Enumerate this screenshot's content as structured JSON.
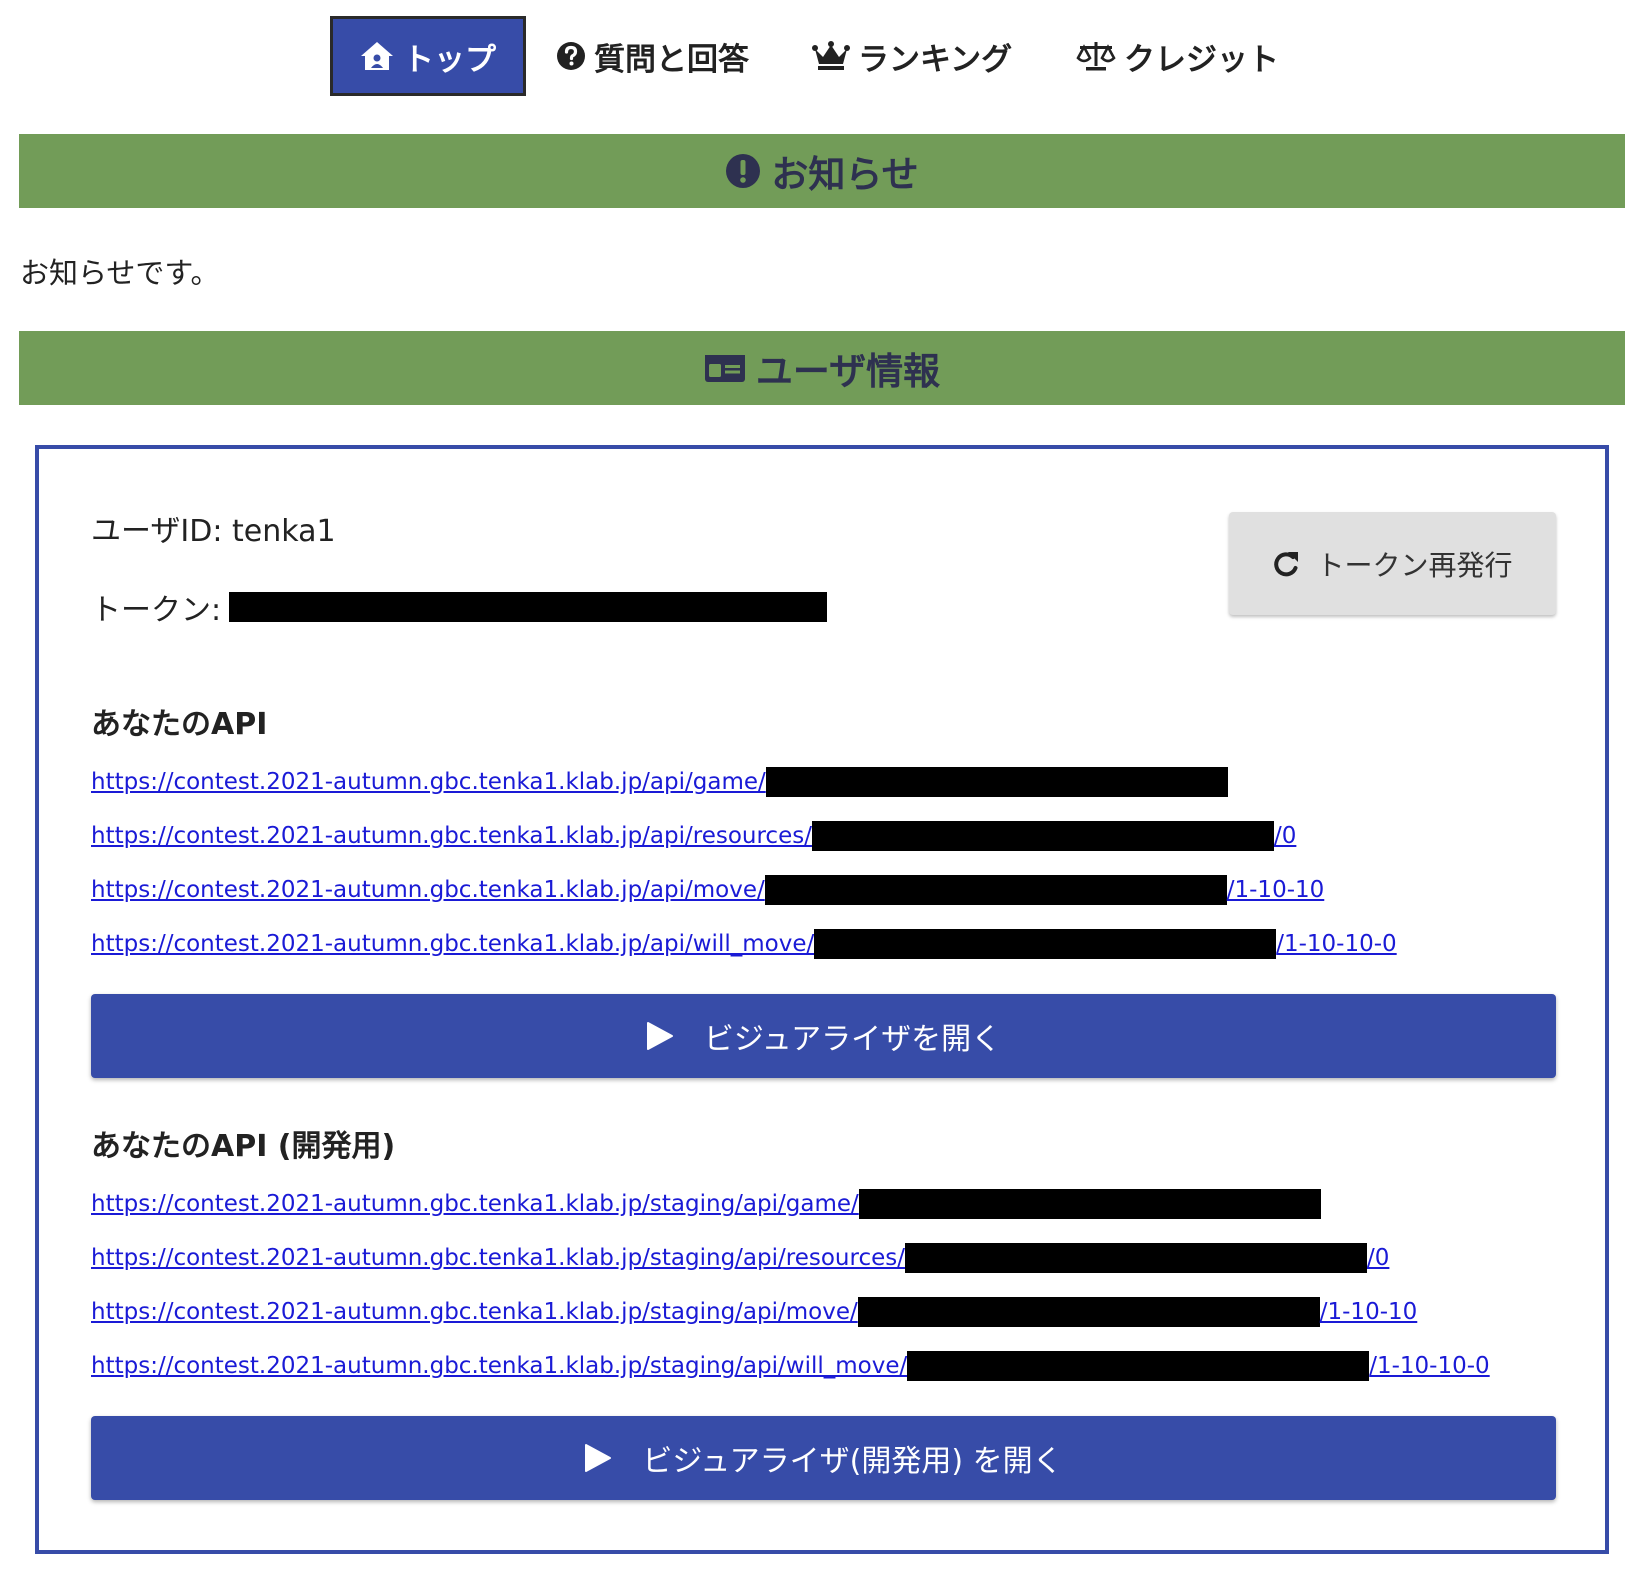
{
  "nav": {
    "items": [
      {
        "label": "トップ",
        "icon": "home-icon",
        "active": true
      },
      {
        "label": "質問と回答",
        "icon": "question-icon",
        "active": false
      },
      {
        "label": "ランキング",
        "icon": "crown-icon",
        "active": false
      },
      {
        "label": "クレジット",
        "icon": "scale-icon",
        "active": false
      }
    ]
  },
  "notice": {
    "title": "お知らせ",
    "icon": "exclamation-circle-icon",
    "text": "お知らせです。"
  },
  "user": {
    "title": "ユーザ情報",
    "icon": "id-card-icon",
    "userid_label": "ユーザID: tenka1",
    "token_label": "トークン:",
    "reissue_label": "トークン再発行",
    "reissue_icon": "redo-icon"
  },
  "api": {
    "heading": "あなたのAPI",
    "links": [
      {
        "prefix": "https://contest.2021-autumn.gbc.tenka1.klab.jp/api/game/",
        "suffix": ""
      },
      {
        "prefix": "https://contest.2021-autumn.gbc.tenka1.klab.jp/api/resources/",
        "suffix": "/0"
      },
      {
        "prefix": "https://contest.2021-autumn.gbc.tenka1.klab.jp/api/move/",
        "suffix": "/1-10-10"
      },
      {
        "prefix": "https://contest.2021-autumn.gbc.tenka1.klab.jp/api/will_move/",
        "suffix": "/1-10-10-0"
      }
    ],
    "visualizer_label": "ビジュアライザを開く"
  },
  "api_dev": {
    "heading": "あなたのAPI (開発用)",
    "links": [
      {
        "prefix": "https://contest.2021-autumn.gbc.tenka1.klab.jp/staging/api/game/",
        "suffix": ""
      },
      {
        "prefix": "https://contest.2021-autumn.gbc.tenka1.klab.jp/staging/api/resources/",
        "suffix": "/0"
      },
      {
        "prefix": "https://contest.2021-autumn.gbc.tenka1.klab.jp/staging/api/move/",
        "suffix": "/1-10-10"
      },
      {
        "prefix": "https://contest.2021-autumn.gbc.tenka1.klab.jp/staging/api/will_move/",
        "suffix": "/1-10-10-0"
      }
    ],
    "visualizer_label": "ビジュアライザ(開発用) を開く"
  },
  "colors": {
    "accent": "#374ca8",
    "section_header": "#729c58",
    "section_header_text": "#2e3150",
    "link": "#1a1ad6"
  }
}
